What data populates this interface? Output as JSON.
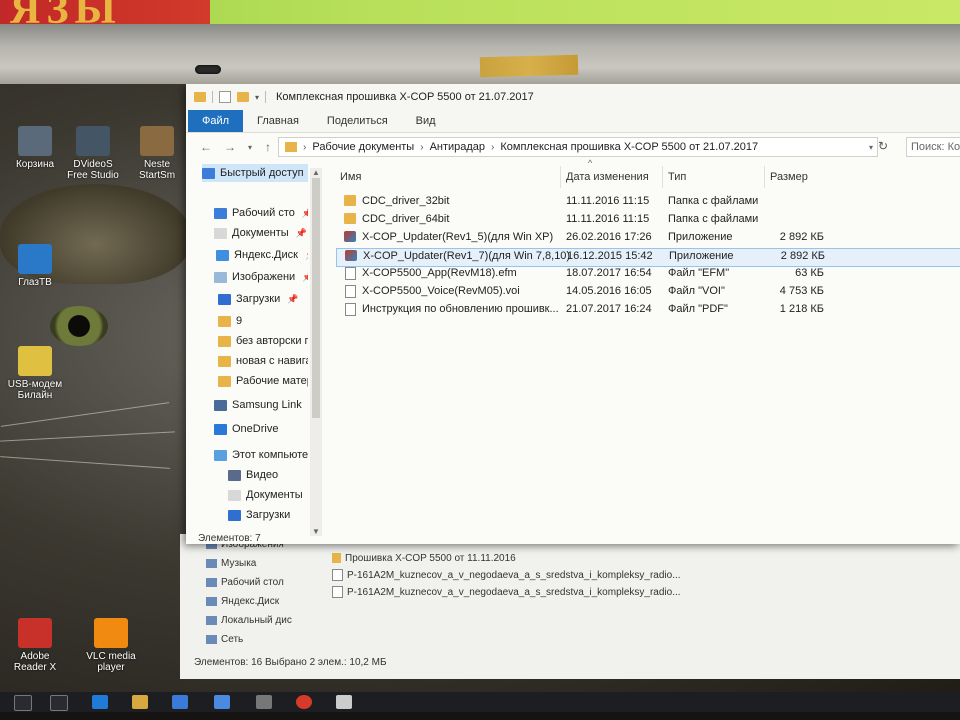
{
  "background": {
    "book_text": "ЯЗЫ"
  },
  "desktop_icons": [
    {
      "label": "Корзина",
      "color": "#5a6a7a"
    },
    {
      "label": "DVideoS\nFree Studio",
      "color": "#445566"
    },
    {
      "label": "Neste\nStartSm",
      "color": "#8a6a40"
    },
    {
      "label": "ГлазТВ",
      "color": "#2a78c8"
    },
    {
      "label": "USB-модем\nБилайн",
      "color": "#e0c040"
    },
    {
      "label": "Adobe\nReader X",
      "color": "#c8302a"
    },
    {
      "label": "VLC media\nplayer",
      "color": "#f08a10"
    }
  ],
  "window": {
    "title": "Комплексная прошивка X-COP 5500 от 21.07.2017",
    "ribbon_tabs": [
      "Файл",
      "Главная",
      "Поделиться",
      "Вид"
    ],
    "address": {
      "crumbs": [
        "Рабочие документы",
        "Антирадар",
        "Комплексная прошивка X-COP 5500 от 21.07.2017"
      ],
      "search_placeholder": "Поиск: Комп"
    },
    "nav": {
      "quick_access": "Быстрый доступ",
      "items": [
        {
          "label": "Рабочий сто",
          "icon": "desktop-icon",
          "color": "#3b7dd8",
          "pin": "📌"
        },
        {
          "label": "Документы",
          "icon": "documents-icon",
          "color": "#d8d8d8",
          "pin": "📌"
        },
        {
          "label": "Яндекс.Диск",
          "icon": "yandex-disk-icon",
          "color": "#3f8fe0",
          "pin": "📌"
        },
        {
          "label": "Изображени",
          "icon": "pictures-icon",
          "color": "#9ab8d8",
          "pin": "📌"
        },
        {
          "label": "Загрузки",
          "icon": "downloads-icon",
          "color": "#2f6fd0",
          "pin": "📌"
        },
        {
          "label": "9",
          "icon": "folder-icon",
          "color": "#e8b44a",
          "pin": ""
        },
        {
          "label": "без авторски пр",
          "icon": "folder-icon",
          "color": "#e8b44a",
          "pin": ""
        },
        {
          "label": "новая с навигац",
          "icon": "folder-icon",
          "color": "#e8b44a",
          "pin": ""
        },
        {
          "label": "Рабочие матер",
          "icon": "folder-icon",
          "color": "#e8b44a",
          "pin": ""
        },
        {
          "label": "Samsung Link",
          "icon": "samsung-link-icon",
          "color": "#4a6a9a",
          "pin": ""
        },
        {
          "label": "OneDrive",
          "icon": "onedrive-icon",
          "color": "#2a78d8",
          "pin": ""
        },
        {
          "label": "Этот компьютер",
          "icon": "computer-icon",
          "color": "#5aa0e0",
          "pin": ""
        },
        {
          "label": "Видео",
          "icon": "video-icon",
          "color": "#5a6a8a",
          "pin": ""
        },
        {
          "label": "Документы",
          "icon": "documents-icon",
          "color": "#d8d8d8",
          "pin": ""
        },
        {
          "label": "Загрузки",
          "icon": "downloads-icon",
          "color": "#2f6fd0",
          "pin": ""
        }
      ]
    },
    "columns": [
      "Имя",
      "Дата изменения",
      "Тип",
      "Размер"
    ],
    "files": [
      {
        "name": "CDC_driver_32bit",
        "date": "11.11.2016 11:15",
        "type": "Папка с файлами",
        "size": "",
        "icon": "folder",
        "selected": false
      },
      {
        "name": "CDC_driver_64bit",
        "date": "11.11.2016 11:15",
        "type": "Папка с файлами",
        "size": "",
        "icon": "folder",
        "selected": false
      },
      {
        "name": "X-COP_Updater(Rev1_5)(для Win XP)",
        "date": "26.02.2016 17:26",
        "type": "Приложение",
        "size": "2 892 КБ",
        "icon": "app",
        "selected": false
      },
      {
        "name": "X-COP_Updater(Rev1_7)(для Win 7,8,10)",
        "date": "16.12.2015 15:42",
        "type": "Приложение",
        "size": "2 892 КБ",
        "icon": "app",
        "selected": true
      },
      {
        "name": "X-COP5500_App(RevM18).efm",
        "date": "18.07.2017 16:54",
        "type": "Файл \"EFM\"",
        "size": "63 КБ",
        "icon": "doc",
        "selected": false
      },
      {
        "name": "X-COP5500_Voice(RevM05).voi",
        "date": "14.05.2016 16:05",
        "type": "Файл \"VOI\"",
        "size": "4 753 КБ",
        "icon": "doc",
        "selected": false
      },
      {
        "name": "Инструкция по обновлению прошивк...",
        "date": "21.07.2017 16:24",
        "type": "Файл \"PDF\"",
        "size": "1 218 КБ",
        "icon": "doc",
        "selected": false
      }
    ],
    "status": "Элементов: 7"
  },
  "back_window": {
    "nav": [
      "Изображения",
      "Музыка",
      "Рабочий стол",
      "Яндекс.Диск",
      "Локальный дис",
      "Сеть"
    ],
    "files": [
      "Прошивка X-COP 5500 от 11.11.2016",
      "P-161A2M_kuznecov_a_v_negodaeva_a_s_sredstva_i_kompleksy_radio...",
      "P-161A2M_kuznecov_a_v_negodaeva_a_s_sredstva_i_kompleksy_radio..."
    ],
    "status": "Элементов: 16    Выбрано 2 элем.: 10,2 МБ"
  }
}
